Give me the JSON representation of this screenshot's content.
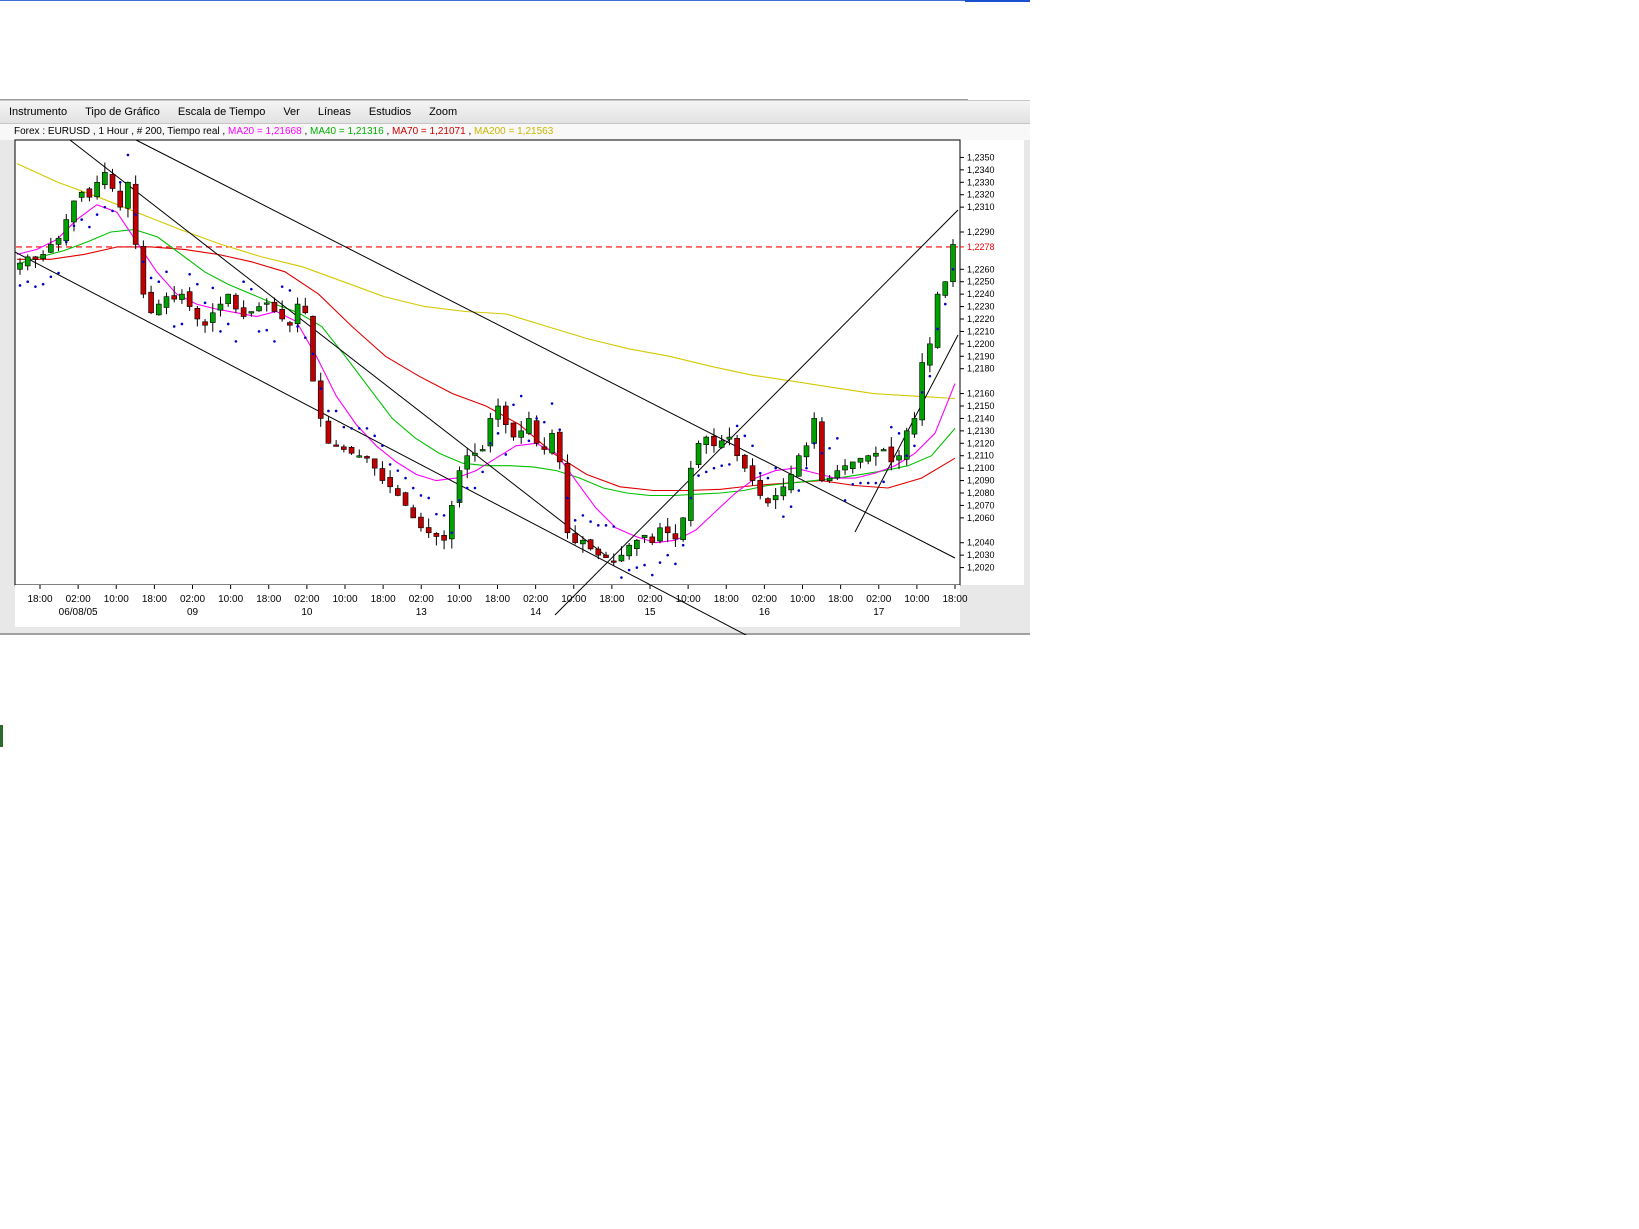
{
  "menu": [
    "Instrumento",
    "Tipo de Gráfico",
    "Escala de Tiempo",
    "Ver",
    "Líneas",
    "Estudios",
    "Zoom"
  ],
  "info": {
    "symbol": "Forex : EURUSD , 1 Hour , # 200, Tiempo real",
    "ma20": "MA20 = 1,21668",
    "ma40": "MA40 = 1,21316",
    "ma70": "MA70 = 1,21071",
    "ma200": "MA200 = 1,21563"
  },
  "colors": {
    "ma20": "#ff00ff",
    "ma40": "#00c000",
    "ma70": "#e00000",
    "ma200": "#d4c800",
    "up_candle": "#00a000",
    "down_candle": "#c00000",
    "sar": "#0000c0",
    "price_line": "#ff0000"
  },
  "chart_data": {
    "type": "candlestick",
    "ylim": [
      1.201,
      1.236
    ],
    "y_ticks": [
      "1,2350",
      "1,2340",
      "1,2330",
      "1,2320",
      "1,2310",
      "1,2290",
      "1,2278",
      "1,2260",
      "1,2250",
      "1,2240",
      "1,2230",
      "1,2220",
      "1,2210",
      "1,2200",
      "1,2190",
      "1,2180",
      "1,2160",
      "1,2150",
      "1,2140",
      "1,2130",
      "1,2120",
      "1,2110",
      "1,2100",
      "1,2090",
      "1,2080",
      "1,2070",
      "1,2060",
      "1,2040",
      "1,2030",
      "1,2020"
    ],
    "current_price": 1.2278,
    "current_price_label": "1,2278",
    "x_tick_labels": [
      "18:00",
      "02:00",
      "10:00",
      "18:00",
      "02:00",
      "10:00",
      "18:00",
      "02:00",
      "10:00",
      "18:00",
      "02:00",
      "10:00",
      "18:00",
      "02:00",
      "10:00",
      "18:00",
      "02:00",
      "10:00",
      "18:00",
      "02:00",
      "10:00",
      "18:00",
      "02:00",
      "10:00",
      "18:00"
    ],
    "x_date_labels": [
      {
        "tick": 1,
        "label": "06/08/05"
      },
      {
        "tick": 4,
        "label": "09"
      },
      {
        "tick": 7,
        "label": "10"
      },
      {
        "tick": 10,
        "label": "13"
      },
      {
        "tick": 13,
        "label": "14"
      },
      {
        "tick": 16,
        "label": "15"
      },
      {
        "tick": 19,
        "label": "16"
      },
      {
        "tick": 22,
        "label": "17"
      }
    ],
    "candle_close_path": [
      1.2265,
      1.227,
      1.2268,
      1.2272,
      1.228,
      1.2285,
      1.23,
      1.2315,
      1.2322,
      1.2318,
      1.233,
      1.2338,
      1.2325,
      1.231,
      1.233,
      1.228,
      1.224,
      1.2225,
      1.2232,
      1.2238,
      1.2236,
      1.224,
      1.223,
      1.222,
      1.2215,
      1.2225,
      1.2232,
      1.224,
      1.2228,
      1.2222,
      1.2226,
      1.223,
      1.2233,
      1.2226,
      1.222,
      1.2215,
      1.2232,
      1.2225,
      1.217,
      1.214,
      1.212,
      1.2118,
      1.2115,
      1.2112,
      1.211,
      1.2108,
      1.21,
      1.209,
      1.2085,
      1.2078,
      1.207,
      1.206,
      1.2052,
      1.2048,
      1.2045,
      1.2042,
      1.207,
      1.2098,
      1.211,
      1.2112,
      1.2115,
      1.214,
      1.215,
      1.2135,
      1.2125,
      1.213,
      1.214,
      1.212,
      1.2115,
      1.2128,
      1.2105,
      1.2048,
      1.204,
      1.2042,
      1.2035,
      1.203,
      1.2028,
      1.2025,
      1.203,
      1.2038,
      1.2042,
      1.2046,
      1.204,
      1.2052,
      1.2048,
      1.2043,
      1.206,
      1.21,
      1.212,
      1.2125,
      1.2118,
      1.2122,
      1.2125,
      1.211,
      1.21,
      1.209,
      1.2078,
      1.2072,
      1.2078,
      1.2085,
      1.2095,
      1.211,
      1.2118,
      1.214,
      1.209,
      1.2092,
      1.2098,
      1.2102,
      1.2105,
      1.2108,
      1.211,
      1.2112,
      1.2115,
      1.2105,
      1.211,
      1.213,
      1.214,
      1.2185,
      1.22,
      1.224,
      1.225,
      1.228
    ],
    "ma20_path": [
      1.2272,
      1.2276,
      1.2284,
      1.23,
      1.2312,
      1.2306,
      1.2282,
      1.2258,
      1.224,
      1.2232,
      1.2228,
      1.2225,
      1.2222,
      1.2226,
      1.2218,
      1.219,
      1.2158,
      1.2135,
      1.2118,
      1.2105,
      1.2095,
      1.209,
      1.2092,
      1.2098,
      1.2108,
      1.2118,
      1.212,
      1.2112,
      1.209,
      1.2068,
      1.2052,
      1.2045,
      1.204,
      1.2042,
      1.205,
      1.2065,
      1.208,
      1.2092,
      1.2098,
      1.21,
      1.2096,
      1.2092,
      1.2092,
      1.2096,
      1.2102,
      1.2112,
      1.2128,
      1.2168
    ],
    "ma40_path": [
      1.2264,
      1.227,
      1.2275,
      1.2282,
      1.229,
      1.2292,
      1.2286,
      1.2272,
      1.2258,
      1.2248,
      1.224,
      1.2232,
      1.2225,
      1.2214,
      1.219,
      1.2165,
      1.214,
      1.2124,
      1.2112,
      1.2104,
      1.2102,
      1.2102,
      1.2101,
      1.2098,
      1.2092,
      1.2084,
      1.208,
      1.2078,
      1.2078,
      1.2079,
      1.208,
      1.2082,
      1.2086,
      1.2088,
      1.209,
      1.2092,
      1.2095,
      1.2098,
      1.2102,
      1.211,
      1.2132
    ],
    "ma70_path": [
      1.2268,
      1.2268,
      1.2272,
      1.2278,
      1.2278,
      1.2276,
      1.2272,
      1.2266,
      1.2258,
      1.224,
      1.2214,
      1.219,
      1.2174,
      1.216,
      1.215,
      1.2135,
      1.2112,
      1.2095,
      1.2085,
      1.2082,
      1.2082,
      1.2083,
      1.2086,
      1.2088,
      1.209,
      1.2086,
      1.2084,
      1.2092,
      1.2108
    ],
    "ma200_path": [
      1.2345,
      1.233,
      1.2318,
      1.2305,
      1.2292,
      1.228,
      1.227,
      1.2262,
      1.225,
      1.2238,
      1.223,
      1.2226,
      1.2224,
      1.2214,
      1.2204,
      1.2196,
      1.219,
      1.2182,
      1.2175,
      1.217,
      1.2165,
      1.216,
      1.2158,
      1.2156
    ]
  }
}
